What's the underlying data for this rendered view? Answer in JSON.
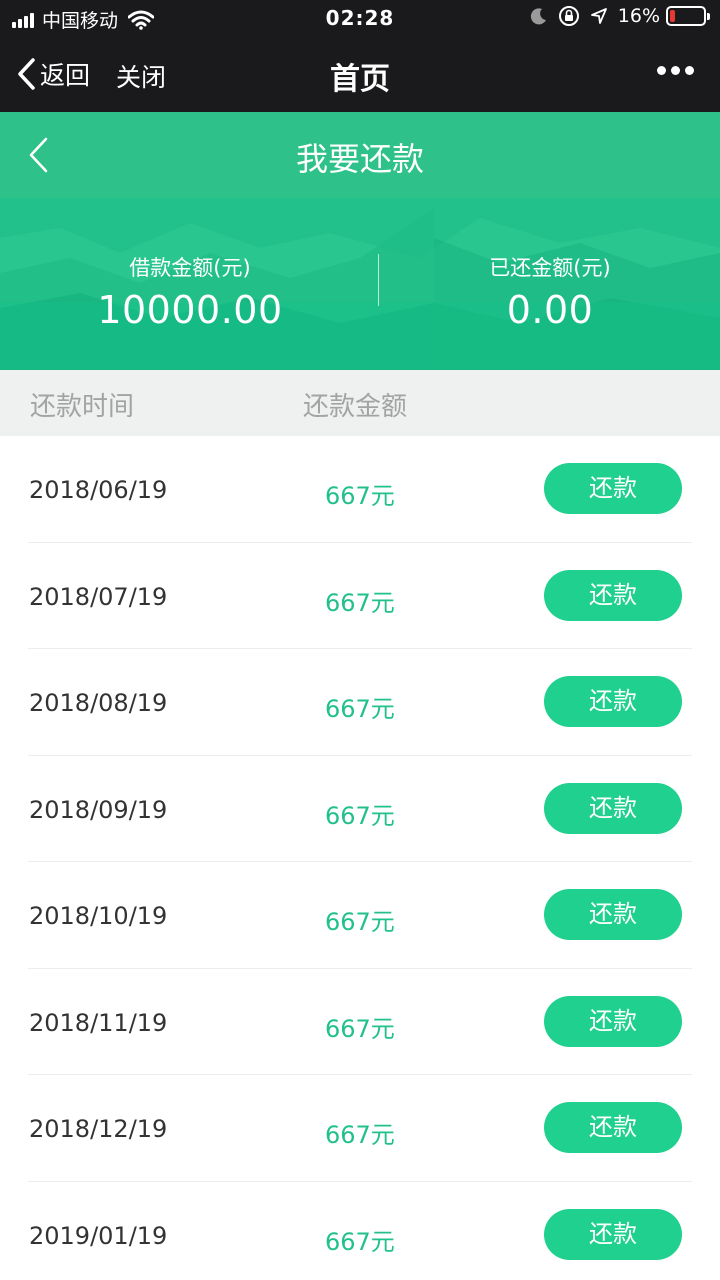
{
  "status_bar": {
    "carrier": "中国移动",
    "time": "02:28",
    "battery_percent_text": "16%",
    "battery_level": 0.16,
    "battery_color": "#e53935"
  },
  "nav": {
    "back_label": "返回",
    "close_label": "关闭",
    "title": "首页"
  },
  "page": {
    "title": "我要还款",
    "accent_color": "#2ec28a"
  },
  "summary": {
    "loan_label": "借款金额(元)",
    "loan_value": "10000.00",
    "repaid_label": "已还金额(元)",
    "repaid_value": "0.00"
  },
  "table": {
    "col_date": "还款时间",
    "col_amount": "还款金额",
    "rows": [
      {
        "date": "2018/06/19",
        "amount": "667元",
        "button": "还款"
      },
      {
        "date": "2018/07/19",
        "amount": "667元",
        "button": "还款"
      },
      {
        "date": "2018/08/19",
        "amount": "667元",
        "button": "还款"
      },
      {
        "date": "2018/09/19",
        "amount": "667元",
        "button": "还款"
      },
      {
        "date": "2018/10/19",
        "amount": "667元",
        "button": "还款"
      },
      {
        "date": "2018/11/19",
        "amount": "667元",
        "button": "还款"
      },
      {
        "date": "2018/12/19",
        "amount": "667元",
        "button": "还款"
      },
      {
        "date": "2019/01/19",
        "amount": "667元",
        "button": "还款"
      }
    ]
  }
}
